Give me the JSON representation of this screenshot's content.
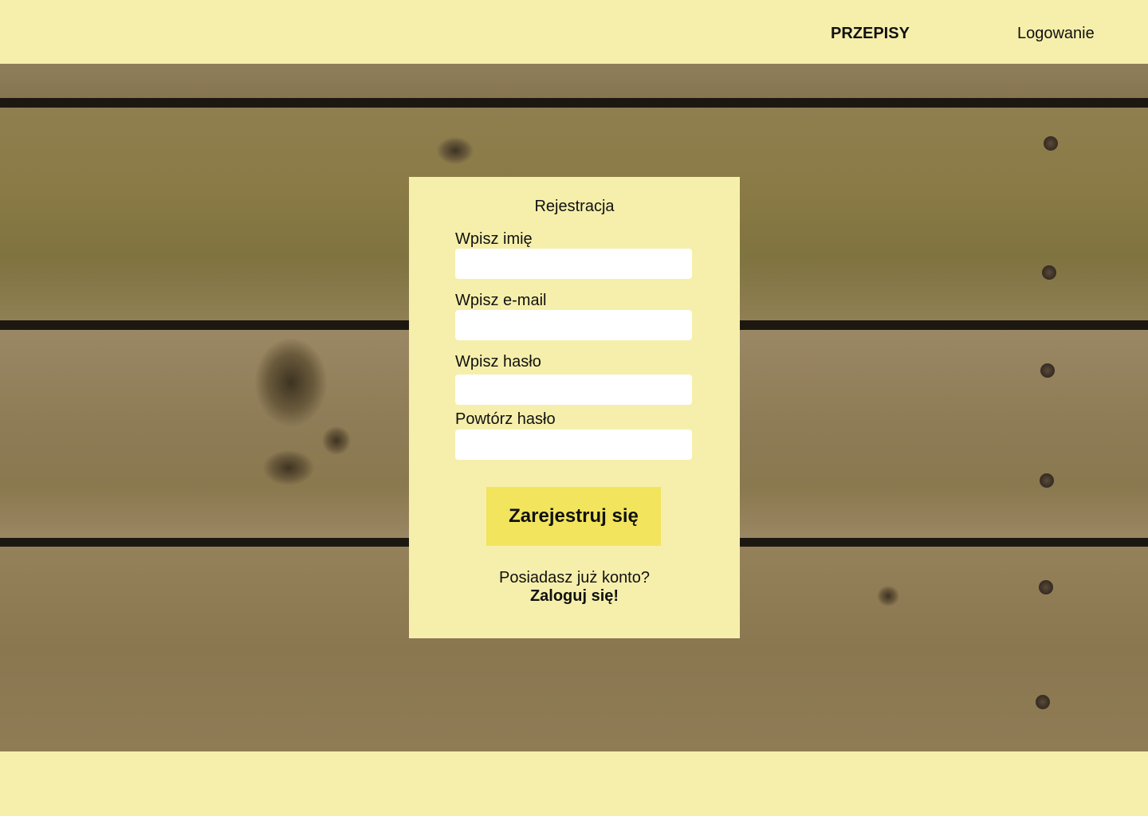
{
  "header": {
    "nav": {
      "recipes_label": "PRZEPISY",
      "login_label": "Logowanie"
    }
  },
  "register_form": {
    "title": "Rejestracja",
    "fields": {
      "name": {
        "label": "Wpisz imię",
        "value": ""
      },
      "email": {
        "label": "Wpisz e-mail",
        "value": ""
      },
      "password": {
        "label": "Wpisz hasło",
        "value": ""
      },
      "password_repeat": {
        "label": "Powtórz hasło",
        "value": ""
      }
    },
    "submit_label": "Zarejestruj się",
    "account_question": "Posiadasz już konto?",
    "login_link_label": "Zaloguj się!"
  },
  "colors": {
    "background": "#f6efab",
    "button": "#f2e45d",
    "input": "#ffffff"
  }
}
